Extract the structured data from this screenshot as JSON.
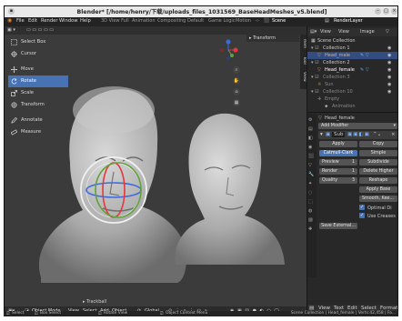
{
  "window": {
    "title": "Blender* [/home/henry/下载/uploads_files_1031569_BaseHeadMeshes_v5.blend]"
  },
  "menu": {
    "items": [
      "File",
      "Edit",
      "Render",
      "Window",
      "Help"
    ],
    "workspaces": [
      "3D View Full",
      "Animation",
      "Compositing",
      "Default",
      "Game Logic",
      "Motion"
    ],
    "scene_label": "Scene",
    "renderlayer_label": "RenderLayer"
  },
  "viewport": {
    "tools": [
      "Select Box",
      "Cursor",
      "Move",
      "Rotate",
      "Scale",
      "Transform",
      "Annotate",
      "Measure"
    ],
    "active_tool": "Rotate",
    "transform_panel_label": "Transform",
    "trackball_label": "Trackball",
    "mode_label": "Object Mode",
    "view_menu": [
      "View",
      "Select",
      "Add",
      "Object"
    ],
    "pivot_label": "Global",
    "side_tabs": [
      "Item",
      "Tool",
      "View"
    ]
  },
  "outliner": {
    "header_buttons": [
      "View",
      "View",
      "Image"
    ],
    "scene_collection": "Scene Collection",
    "items": [
      {
        "name": "Collection 1"
      },
      {
        "name": "Head_male"
      },
      {
        "name": "Collection 2"
      },
      {
        "name": "Head_female"
      },
      {
        "name": "Collection 3"
      },
      {
        "name": "Sun"
      },
      {
        "name": "Collection 10"
      },
      {
        "name": "Empty"
      },
      {
        "name": "Animation"
      }
    ]
  },
  "properties": {
    "object_name": "Head_female",
    "add_modifier": "Add Modifier",
    "modifier_name": "Sub",
    "apply": "Apply",
    "copy": "Copy",
    "catmull": "Catmull-Clark",
    "simple": "Simple",
    "preview_label": "Preview",
    "preview_value": "1",
    "render_label": "Render",
    "render_value": "1",
    "quality_label": "Quality",
    "quality_value": "3",
    "subdivide": "Subdivide",
    "delete_higher": "Delete Higher",
    "reshape": "Reshape",
    "apply_base": "Apply Base",
    "smooth_label": "Smooth, Kee...",
    "optimal": "Optimal Di",
    "use_creases": "Use Creases",
    "save_external": "Save External..."
  },
  "bottom_tabs": [
    "View",
    "Text",
    "Edit",
    "Select",
    "Format"
  ],
  "status": {
    "select": "Select",
    "box_select": "Box Select",
    "rotate_view": "Rotate View",
    "context_menu": "Object Context Menu",
    "info": "Scene Collection | Head_female | Verts:42,458 | Fa..."
  },
  "colors": {
    "active_blue": "#4772b3",
    "rotate_red": "#e23a3a",
    "rotate_green": "#5fa33a",
    "rotate_blue": "#3a6be2"
  }
}
